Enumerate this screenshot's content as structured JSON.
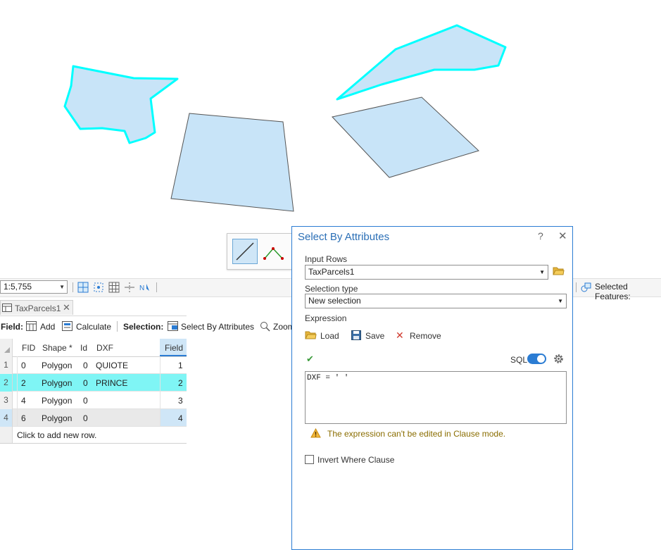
{
  "map": {
    "parcels": [
      {
        "id": "parcel-west",
        "selected": true
      },
      {
        "id": "parcel-center",
        "selected": false
      },
      {
        "id": "parcel-northeast",
        "selected": true
      },
      {
        "id": "parcel-east",
        "selected": false
      }
    ],
    "fill_color": "#c8e4f8",
    "selected_outline": "#00ffff",
    "outline": "#555555"
  },
  "status_bar": {
    "scale": "1:5,755",
    "selected_features_label": "Selected Features:"
  },
  "table_tab": {
    "label": "TaxParcels1"
  },
  "table_toolbar": {
    "field_label": "Field:",
    "add_label": "Add",
    "calculate_label": "Calculate",
    "selection_label": "Selection:",
    "select_by_attributes_label": "Select By Attributes",
    "zoom_label": "Zoom"
  },
  "attribute_table": {
    "columns": [
      "FID",
      "Shape *",
      "Id",
      "DXF",
      "Field"
    ],
    "rows": [
      {
        "num": "1",
        "fid": "0",
        "shape": "Polygon",
        "id": "0",
        "dxf": "QUIOTE",
        "field": "1",
        "selected": false
      },
      {
        "num": "2",
        "fid": "2",
        "shape": "Polygon",
        "id": "0",
        "dxf": "PRINCE",
        "field": "2",
        "selected": true
      },
      {
        "num": "3",
        "fid": "4",
        "shape": "Polygon",
        "id": "0",
        "dxf": "",
        "field": "3",
        "selected": false
      },
      {
        "num": "4",
        "fid": "6",
        "shape": "Polygon",
        "id": "0",
        "dxf": "",
        "field": "4",
        "selected": false
      }
    ],
    "add_row_label": "Click to add new row.",
    "selected_row_color": "#7ff5f5",
    "active_cell_color": "#cfe6f7"
  },
  "dialog": {
    "title": "Select By Attributes",
    "help": "?",
    "close": "✕",
    "input_rows_label": "Input Rows",
    "input_rows_value": "TaxParcels1",
    "selection_type_label": "Selection type",
    "selection_type_value": "New selection",
    "expression_label": "Expression",
    "load_label": "Load",
    "save_label": "Save",
    "remove_label": "Remove",
    "sql_label": "SQL",
    "sql_toggle_on": true,
    "sql_text": "DXF = ' '",
    "warning_text": "The expression can't be edited in Clause mode.",
    "invert_label": "Invert Where Clause",
    "invert_checked": false
  }
}
